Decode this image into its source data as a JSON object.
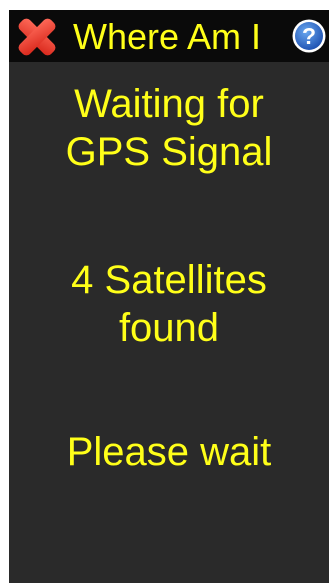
{
  "app": {
    "title": "Where Am I",
    "accent_color": "#ffff19",
    "background_color": "#2a2a2a",
    "titlebar_color": "#0a0a0a"
  },
  "toolbar": {
    "close_icon": "close-icon",
    "help_icon": "help-icon",
    "help_glyph": "?"
  },
  "status": {
    "line1": "Waiting for",
    "line2": "GPS Signal",
    "line3": "4 Satellites",
    "line4": "found",
    "line5": "Please wait"
  }
}
